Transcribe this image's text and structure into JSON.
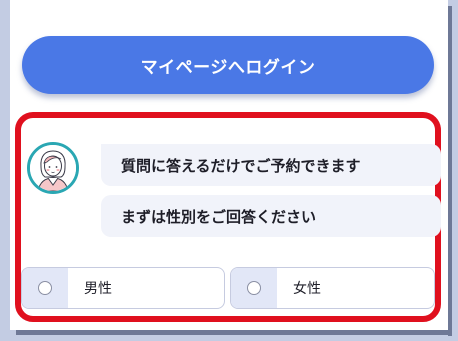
{
  "login_button": {
    "label": "マイページへログイン"
  },
  "chat": {
    "messages": [
      "質問に答えるだけでご予約できます",
      "まずは性別をご回答ください"
    ],
    "options": [
      {
        "label": "男性",
        "selected": false
      },
      {
        "label": "女性",
        "selected": false
      }
    ]
  },
  "colors": {
    "primary": "#4a78e6",
    "highlight_border": "#e0101e",
    "avatar_ring": "#2aa7b3",
    "bubble_bg": "#f1f3fa"
  },
  "icons": {
    "avatar": "receptionist-avatar-icon"
  }
}
